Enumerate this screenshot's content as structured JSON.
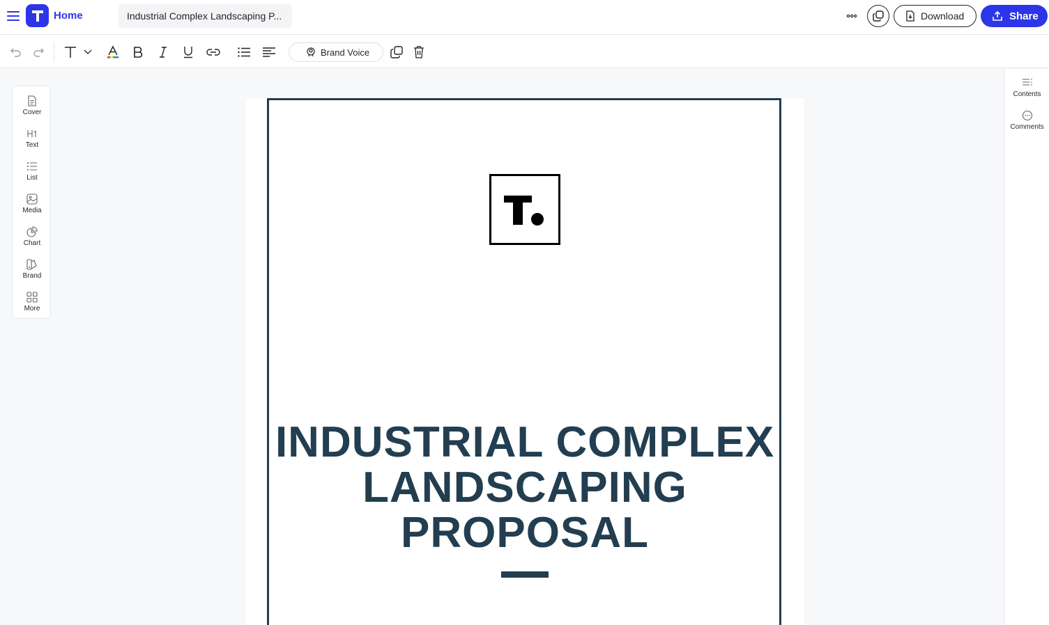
{
  "header": {
    "home_label": "Home",
    "doc_title": "Industrial Complex Landscaping P...",
    "download_label": "Download",
    "share_label": "Share"
  },
  "toolbar": {
    "brand_voice_label": "Brand Voice"
  },
  "left_panel": {
    "items": [
      {
        "label": "Cover",
        "icon": "cover-icon"
      },
      {
        "label": "Text",
        "icon": "heading-icon"
      },
      {
        "label": "List",
        "icon": "list-icon"
      },
      {
        "label": "Media",
        "icon": "image-icon"
      },
      {
        "label": "Chart",
        "icon": "pie-chart-icon"
      },
      {
        "label": "Brand",
        "icon": "brand-icon"
      },
      {
        "label": "More",
        "icon": "grid-icon"
      }
    ]
  },
  "right_panel": {
    "items": [
      {
        "label": "Contents",
        "icon": "contents-icon"
      },
      {
        "label": "Comments",
        "icon": "comment-icon"
      }
    ]
  },
  "document": {
    "title_line1": "INDUSTRIAL COMPLEX",
    "title_line2": "LANDSCAPING",
    "title_line3": "PROPOSAL",
    "logo_text": "T"
  },
  "colors": {
    "accent": "#2d35e8",
    "title": "#223e50"
  }
}
